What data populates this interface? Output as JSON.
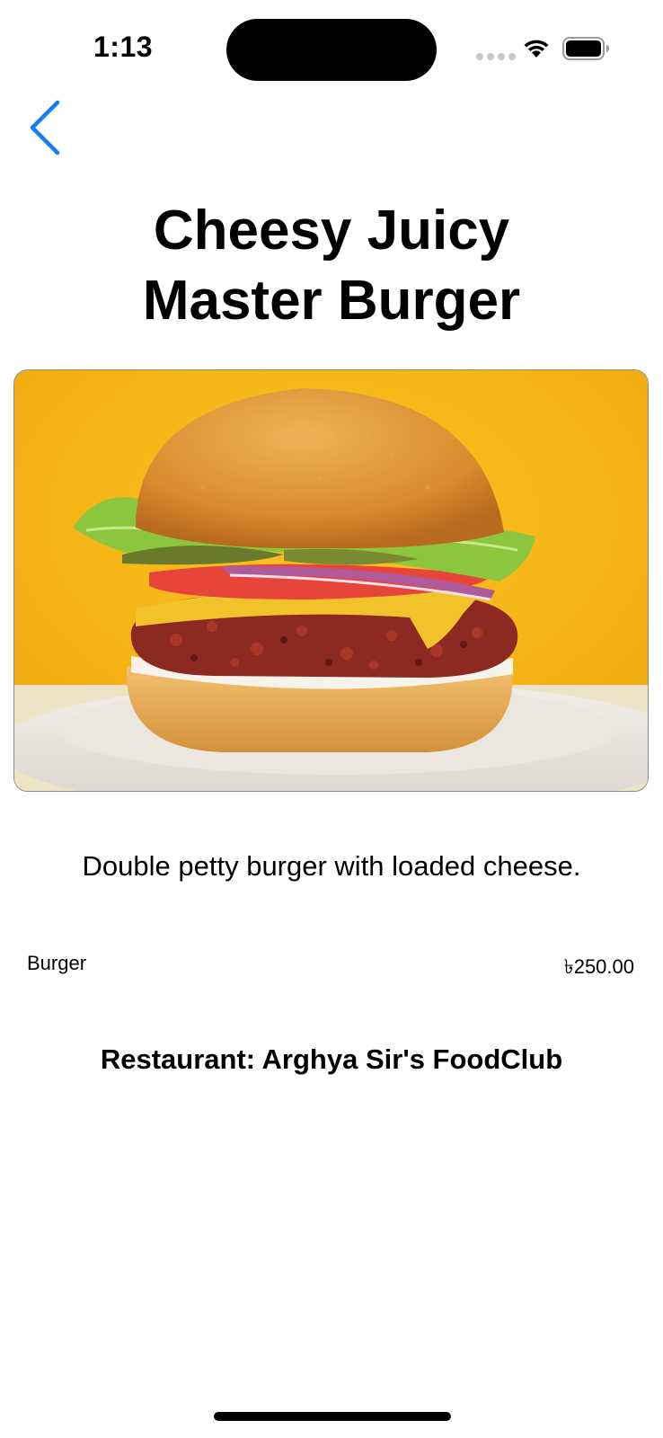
{
  "status_bar": {
    "time": "1:13"
  },
  "nav": {
    "back_icon": "chevron-left-icon",
    "accent_color": "#1a7cf5"
  },
  "item": {
    "title_line1": "Cheesy Juicy",
    "title_line2": "Master Burger",
    "image_alt": "burger-photo",
    "description": "Double petty burger with loaded cheese.",
    "category": "Burger",
    "price": "৳250.00",
    "restaurant": "Restaurant: Arghya Sir's FoodClub"
  },
  "colors": {
    "image_background": "#f6b713"
  }
}
